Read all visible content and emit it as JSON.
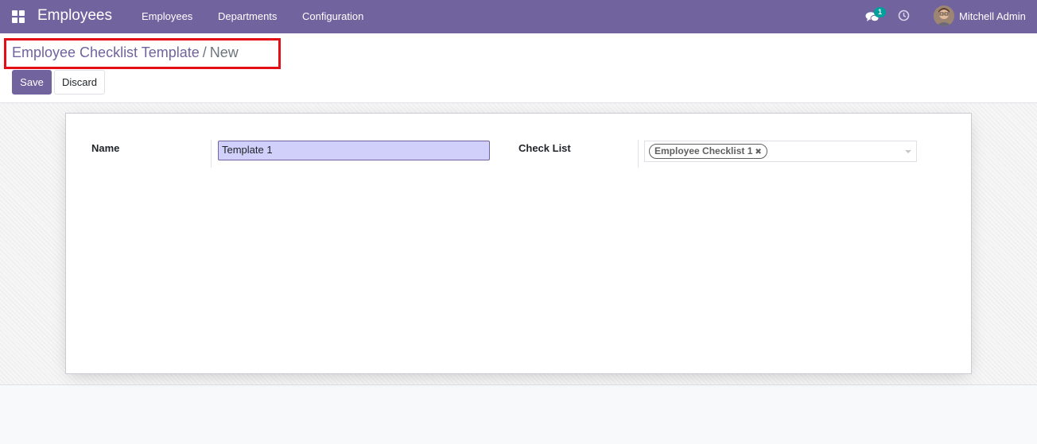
{
  "navbar": {
    "app_title": "Employees",
    "menu": [
      {
        "label": "Employees"
      },
      {
        "label": "Departments"
      },
      {
        "label": "Configuration"
      }
    ],
    "chat_badge": "1",
    "user_name": "Mitchell Admin",
    "icons": [
      "apps-icon",
      "chat-icon",
      "clock-icon"
    ],
    "color": "#71639e"
  },
  "control_panel": {
    "breadcrumb_parent": "Employee Checklist Template",
    "breadcrumb_separator": "/",
    "breadcrumb_current": "New",
    "save_label": "Save",
    "discard_label": "Discard"
  },
  "form": {
    "name_label": "Name",
    "name_value": "Template 1",
    "checklist_label": "Check List",
    "checklist_tags": [
      {
        "label": "Employee Checklist 1"
      }
    ]
  },
  "colors": {
    "primary": "#71639e",
    "highlight": "#e40f15",
    "input_bg": "#d0d0fb"
  }
}
